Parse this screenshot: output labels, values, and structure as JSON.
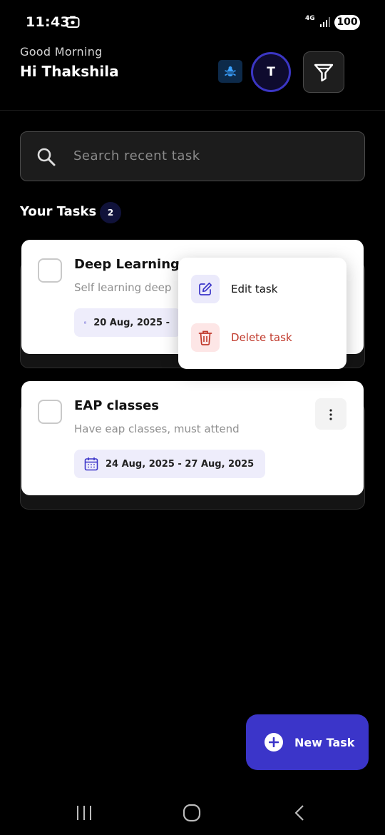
{
  "status_bar": {
    "time": "11:43",
    "network": "4G",
    "battery": "100"
  },
  "header": {
    "greeting": "Good Morning",
    "user_name": "Hi Thakshila",
    "avatar_initial": "T"
  },
  "search": {
    "placeholder": "Search recent task",
    "value": ""
  },
  "tasks_section": {
    "title": "Your Tasks",
    "count": "2"
  },
  "tasks": [
    {
      "title": "Deep Learning",
      "description": "Self learning deep",
      "date_range": "20 Aug, 2025 -",
      "completed": false
    },
    {
      "title": "EAP classes",
      "description": "Have eap classes, must attend",
      "date_range": "24 Aug, 2025 - 27 Aug, 2025",
      "completed": false
    }
  ],
  "context_menu": {
    "edit_label": "Edit task",
    "delete_label": "Delete task"
  },
  "fab": {
    "label": "New Task"
  },
  "colors": {
    "accent": "#3b35c9",
    "danger": "#c0392b",
    "chip_bg": "#eeedfb"
  }
}
